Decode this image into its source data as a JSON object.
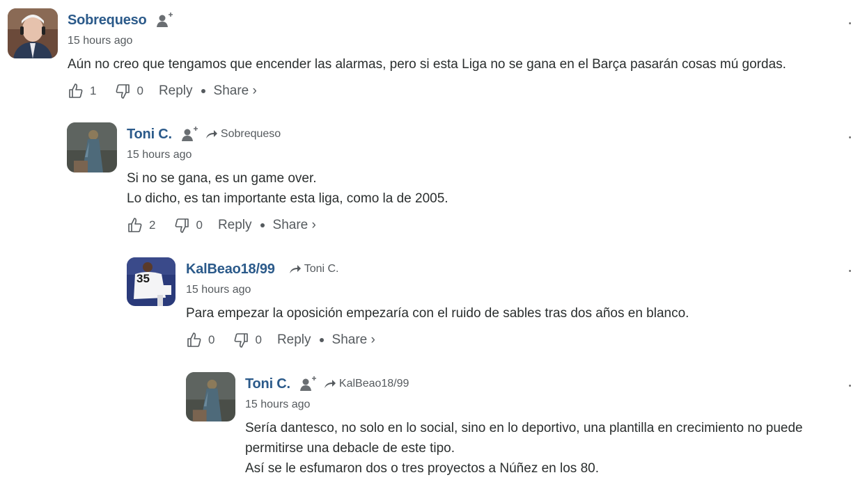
{
  "comments": [
    {
      "author": "Sobrequeso",
      "reply_to": "",
      "time": "15 hours ago",
      "text": "Aún no creo que tengamos que encender las alarmas, pero si esta Liga no se gana en el Barça pasarán cosas mú gordas.",
      "upvotes": "1",
      "downvotes": "0",
      "reply_label": "Reply",
      "share_label": "Share ›"
    },
    {
      "author": "Toni C.",
      "reply_to": "Sobrequeso",
      "time": "15 hours ago",
      "text": "Si no se gana, es un game over.\nLo dicho, es tan importante esta liga, como la de 2005.",
      "upvotes": "2",
      "downvotes": "0",
      "reply_label": "Reply",
      "share_label": "Share ›"
    },
    {
      "author": "KalBeao18/99",
      "reply_to": "Toni C.",
      "time": "15 hours ago",
      "text": "Para empezar la oposición empezaría con el ruido de sables tras dos años en blanco.",
      "upvotes": "0",
      "downvotes": "0",
      "reply_label": "Reply",
      "share_label": "Share ›"
    },
    {
      "author": "Toni C.",
      "reply_to": "KalBeao18/99",
      "time": "15 hours ago",
      "text": "Sería dantesco, no solo en lo social, sino en lo deportivo, una plantilla en crecimiento no puede permitirse una debacle de este tipo.\nAsí se le esfumaron dos o tres proyectos a Núñez en los 80.",
      "upvotes": "",
      "downvotes": "",
      "reply_label": "",
      "share_label": ""
    }
  ],
  "jersey_number": "35",
  "colors": {
    "author": "#2b5a8a",
    "meta": "#555a5e",
    "text": "#2a2e2e"
  }
}
